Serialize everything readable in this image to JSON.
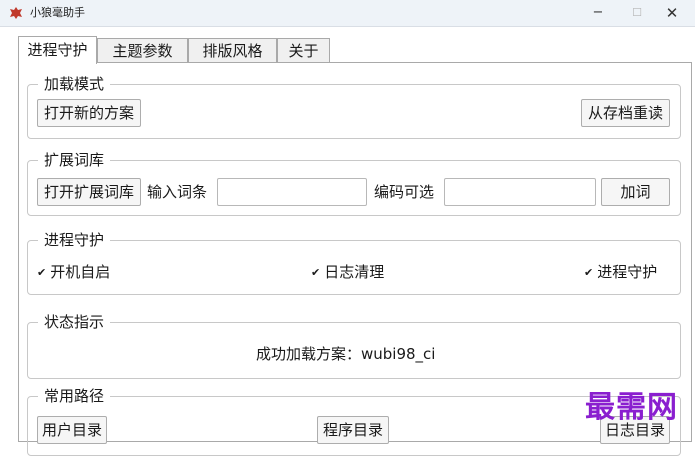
{
  "window": {
    "title": "小狼毫助手",
    "minimize": "−",
    "maximize": "☐",
    "close": "✕"
  },
  "tabs": [
    {
      "label": "进程守护"
    },
    {
      "label": "主题参数"
    },
    {
      "label": "排版风格"
    },
    {
      "label": "关于"
    }
  ],
  "load_mode": {
    "title": "加载模式",
    "open_new_scheme": "打开新的方案",
    "reload_from_archive": "从存档重读"
  },
  "ext_dict": {
    "title": "扩展词库",
    "open_ext_dict": "打开扩展词库",
    "input_term_label": "输入词条",
    "input_term_value": "",
    "code_optional_label": "编码可选",
    "code_value": "",
    "add_word": "加词"
  },
  "process_guard": {
    "title": "进程守护",
    "autostart": {
      "label": "开机自启",
      "checked": true
    },
    "log_cleanup": {
      "label": "日志清理",
      "checked": true
    },
    "process_guard": {
      "label": "进程守护",
      "checked": true
    }
  },
  "status": {
    "title": "状态指示",
    "message": "成功加载方案：wubi98_ci"
  },
  "common_paths": {
    "title": "常用路径",
    "user_dir": "用户目录",
    "program_dir": "程序目录",
    "log_dir": "日志目录"
  },
  "watermark": "最需网",
  "colors": {
    "watermark": "#8a1fcf",
    "app_icon": "#c0392b"
  }
}
